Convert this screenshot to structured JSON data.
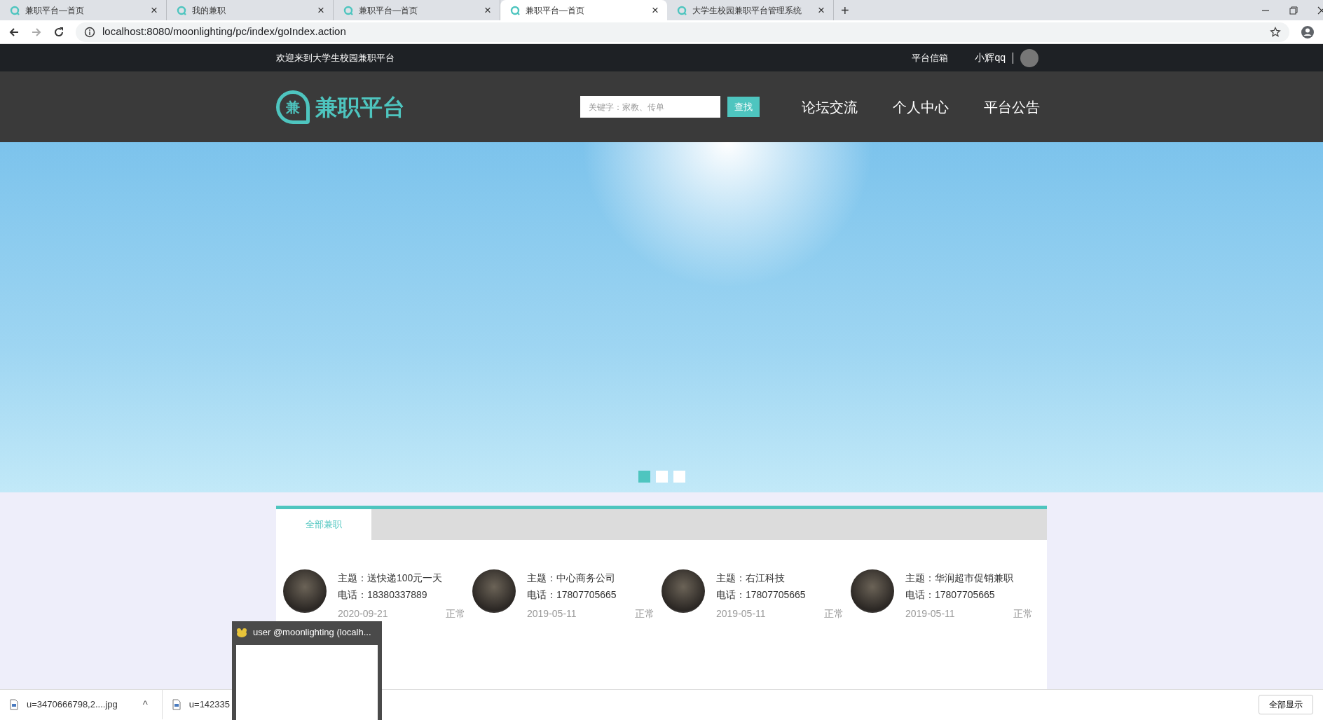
{
  "browser": {
    "tabs": [
      {
        "title": "兼职平台—首页",
        "selected": false
      },
      {
        "title": "我的兼职",
        "selected": false
      },
      {
        "title": "兼职平台—首页",
        "selected": false
      },
      {
        "title": "兼职平台—首页",
        "selected": true
      },
      {
        "title": "大学生校园兼职平台管理系统",
        "selected": false
      }
    ],
    "tab_close": "×",
    "new_tab": "+",
    "address": "localhost:8080/moonlighting/pc/index/goIndex.action"
  },
  "topbar": {
    "welcome": "欢迎来到大学生校园兼职平台",
    "mailbox": "平台信箱",
    "username": "小辉qq"
  },
  "header": {
    "logo_mark": "兼",
    "logo_text": "兼职平台",
    "search": {
      "placeholder": "关键字：家教、传单"
    },
    "search_button": "查找",
    "nav": [
      "论坛交流",
      "个人中心",
      "平台公告"
    ]
  },
  "carousel": {
    "indicators": [
      {
        "selected": true
      },
      {
        "selected": false
      },
      {
        "selected": false
      }
    ]
  },
  "jobs": {
    "tabs": [
      {
        "label": "全部兼职",
        "selected": true
      }
    ],
    "items": [
      {
        "subject": "主题：送快递100元一天",
        "phone": "电话：18380337889",
        "date": "2020-09-21",
        "status": "正常"
      },
      {
        "subject": "主题：中心商务公司",
        "phone": "电话：17807705665",
        "date": "2019-05-11",
        "status": "正常"
      },
      {
        "subject": "主题：右江科技",
        "phone": "电话：17807705665",
        "date": "2019-05-11",
        "status": "正常"
      },
      {
        "subject": "主题：华润超市促销兼职",
        "phone": "电话：17807705665",
        "date": "2019-05-11",
        "status": "正常"
      }
    ]
  },
  "taskbar_preview": {
    "title": "user @moonlighting (localh..."
  },
  "downloads": {
    "items": [
      "u=3470666798,2....jpg",
      "u=142335"
    ],
    "caret": "^",
    "show_all": "全部显示"
  }
}
